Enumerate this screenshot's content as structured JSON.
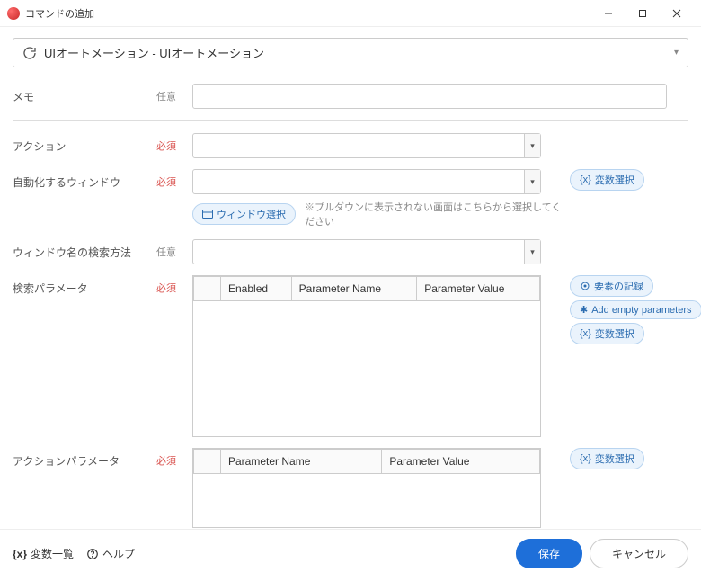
{
  "window": {
    "title": "コマンドの追加"
  },
  "commandSelector": {
    "text": "UIオートメーション - UIオートメーション"
  },
  "labels": {
    "memo": "メモ",
    "action": "アクション",
    "targetWindow": "自動化するウィンドウ",
    "windowNameSearch": "ウィンドウ名の検索方法",
    "searchParams": "検索パラメータ",
    "actionParams": "アクションパラメータ"
  },
  "req": {
    "optional": "任意",
    "required": "必須"
  },
  "buttons": {
    "windowSelect": "ウィンドウ選択",
    "varSelect": "変数選択",
    "recordElement": "要素の記録",
    "addEmptyParams": "Add empty parameters",
    "save": "保存",
    "cancel": "キャンセル"
  },
  "hints": {
    "pulldownHint": "※プルダウンに表示されない画面はこちらから選択してください"
  },
  "table1": {
    "h1": "Enabled",
    "h2": "Parameter Name",
    "h3": "Parameter Value"
  },
  "table2": {
    "h1": "Parameter Name",
    "h2": "Parameter Value"
  },
  "footer": {
    "varList": "変数一覧",
    "help": "ヘルプ"
  }
}
